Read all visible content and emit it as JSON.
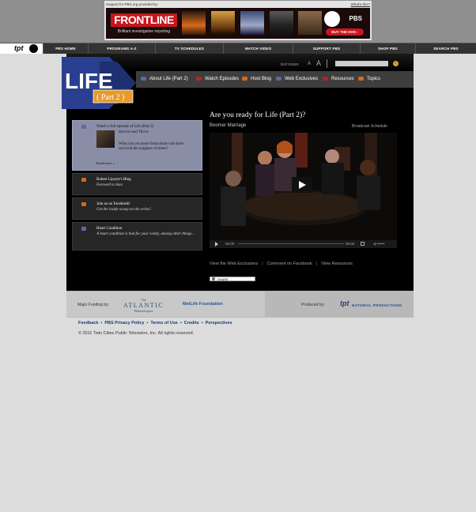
{
  "ad": {
    "support_text": "Support for PBS.org provided by:",
    "whats_this": "What's this?",
    "brand": "FRONTLINE",
    "tagline": "Brilliant investigative reporting",
    "pbs_label": "PBS",
    "buy_label": "BUY THE DVD ›"
  },
  "nav": {
    "logo_text": "tpt",
    "items": [
      "PBS HOME",
      "PROGRAMS A-Z",
      "TV SCHEDULES",
      "WATCH VIDEO",
      "SUPPORT PBS",
      "SHOP PBS",
      "SEARCH PBS"
    ]
  },
  "header": {
    "text_resize": "text resize",
    "small_a": "A",
    "large_a": "A",
    "search_placeholder": "",
    "search_go": "›"
  },
  "logo": {
    "title": "LIFE",
    "part": "( Part 2 )"
  },
  "subnav": {
    "items": [
      {
        "label": "About Life (Part 2)",
        "color": "#5a6aa8"
      },
      {
        "label": "Watch Episodes",
        "color": "#b52424"
      },
      {
        "label": "Host Blog",
        "color": "#d46a1c"
      },
      {
        "label": "Web Exclusives",
        "color": "#5a6aa8"
      },
      {
        "label": "Resources",
        "color": "#b52424"
      },
      {
        "label": "Topics",
        "color": "#d46a1c"
      }
    ]
  },
  "panels": {
    "watch": {
      "title": "Watch a full episode of Life (Part 2)",
      "sub": "Survive and Thrive",
      "desc": "What can you learn from those who have survived the toughest of times?",
      "more": "Read more »"
    },
    "blog": {
      "title": "Robert Lipsyte's Blog",
      "sub": "Farewell to Asia"
    },
    "facebook": {
      "title": "Join us on Facebook!",
      "sub": "Get the inside scoop on the series!"
    },
    "heart": {
      "title": "Heart Condition",
      "sub": "A heart condition is bad for your vanity, among other things..."
    }
  },
  "main": {
    "heading": "Are you ready for Life (Part 2)?",
    "subheading": "Boomer Marriage",
    "broadcast": "Broadcast Schedule",
    "time_start": "00:00",
    "time_end": "00:00",
    "volume": "◂) ••••••",
    "links": [
      "View the Web Exclusives",
      "Comment on Facebook",
      "View Resources"
    ],
    "share": "SHARE"
  },
  "funding": {
    "label": "Major Funding by:",
    "atlantic_the": "The",
    "atlantic_name": "ATLANTIC",
    "atlantic_ph": "Philanthropies",
    "metlife": "MetLife Foundation",
    "produced": "Produced by:",
    "tpt": "tpt",
    "natprod": "NATIONAL PRODUCTIONS"
  },
  "footer": {
    "links": [
      "Feedback",
      "PBS Privacy Policy",
      "Terms of Use",
      "Credits",
      "Perspectives"
    ],
    "copyright": "© 2011 Twin Cities Public Television, Inc. All rights reserved."
  }
}
